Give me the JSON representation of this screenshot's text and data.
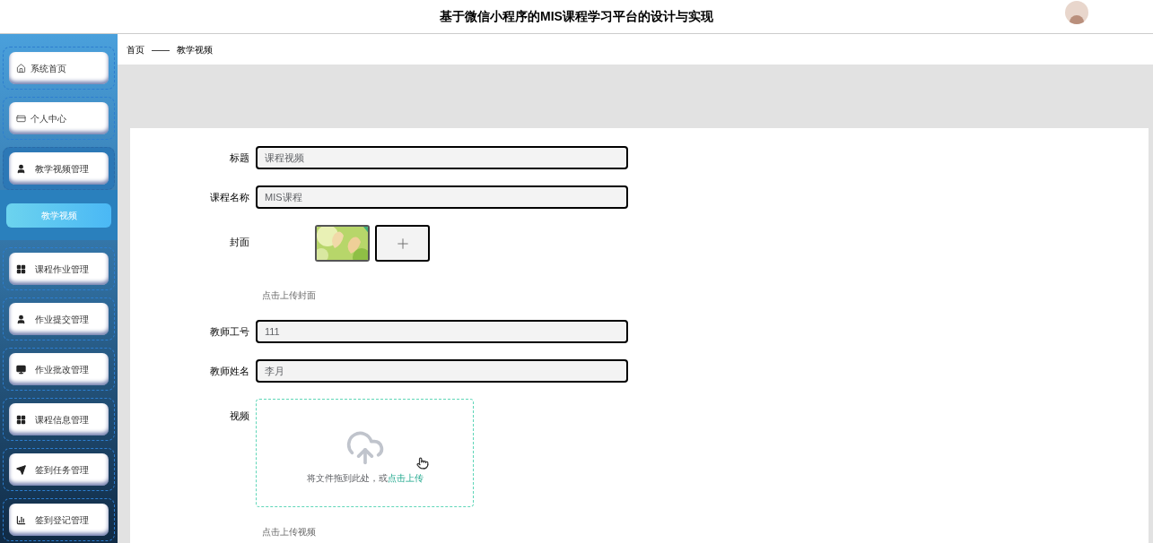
{
  "header": {
    "title": "基于微信小程序的MIS课程学习平台的设计与实现"
  },
  "sidebar": {
    "items": [
      {
        "label": "系统首页",
        "expanded": false
      },
      {
        "label": "个人中心",
        "expanded": false
      },
      {
        "label": "教学视频管理",
        "expanded": true,
        "children": [
          {
            "label": "教学视频",
            "selected": true
          }
        ]
      },
      {
        "label": "课程作业管理",
        "expanded": false
      },
      {
        "label": "作业提交管理",
        "expanded": false
      },
      {
        "label": "作业批改管理",
        "expanded": false
      },
      {
        "label": "课程信息管理",
        "expanded": false
      },
      {
        "label": "签到任务管理",
        "expanded": false
      },
      {
        "label": "签到登记管理",
        "expanded": false
      }
    ]
  },
  "breadcrumb": [
    "首页",
    "——",
    "教学视频"
  ],
  "form": {
    "fields": [
      {
        "kind": "text",
        "label": "标题",
        "value": "课程视频"
      },
      {
        "kind": "text",
        "label": "课程名称",
        "value": "MIS课程"
      },
      {
        "label": "封面",
        "hint": "点击上传封面"
      },
      {
        "kind": "text",
        "label": "教师工号",
        "value": "111"
      },
      {
        "kind": "text",
        "label": "教师姓名",
        "value": "李月"
      },
      {
        "kind": "upload",
        "label": "视频",
        "drop_text": "将文件拖到此处，或",
        "link": "点击上传",
        "hint": "点击上传视频"
      }
    ]
  }
}
